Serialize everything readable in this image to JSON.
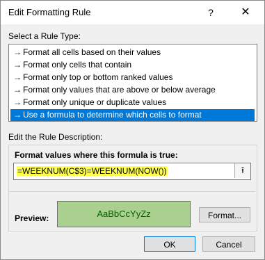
{
  "window": {
    "title": "Edit Formatting Rule",
    "help_label": "?",
    "close_label": "✕"
  },
  "rule_type": {
    "heading": "Select a Rule Type:",
    "items": [
      "Format all cells based on their values",
      "Format only cells that contain",
      "Format only top or bottom ranked values",
      "Format only values that are above or below average",
      "Format only unique or duplicate values",
      "Use a formula to determine which cells to format"
    ],
    "selected_index": 5,
    "item_icon": "arrow-icon"
  },
  "description": {
    "heading": "Edit the Rule Description:",
    "formula_label": "Format values where this formula is true:",
    "formula_value": "=WEEKNUM(C$3)=WEEKNUM(NOW())",
    "collapse_icon": "range-selector-icon",
    "preview_label": "Preview:",
    "preview_text": "AaBbCcYyZz",
    "preview_fill": "#a9d08e",
    "preview_font_color": "#006100",
    "format_button": "Format..."
  },
  "buttons": {
    "ok": "OK",
    "cancel": "Cancel"
  },
  "colors": {
    "selection": "#0078d7",
    "formula_highlight": "#ffff4d"
  }
}
